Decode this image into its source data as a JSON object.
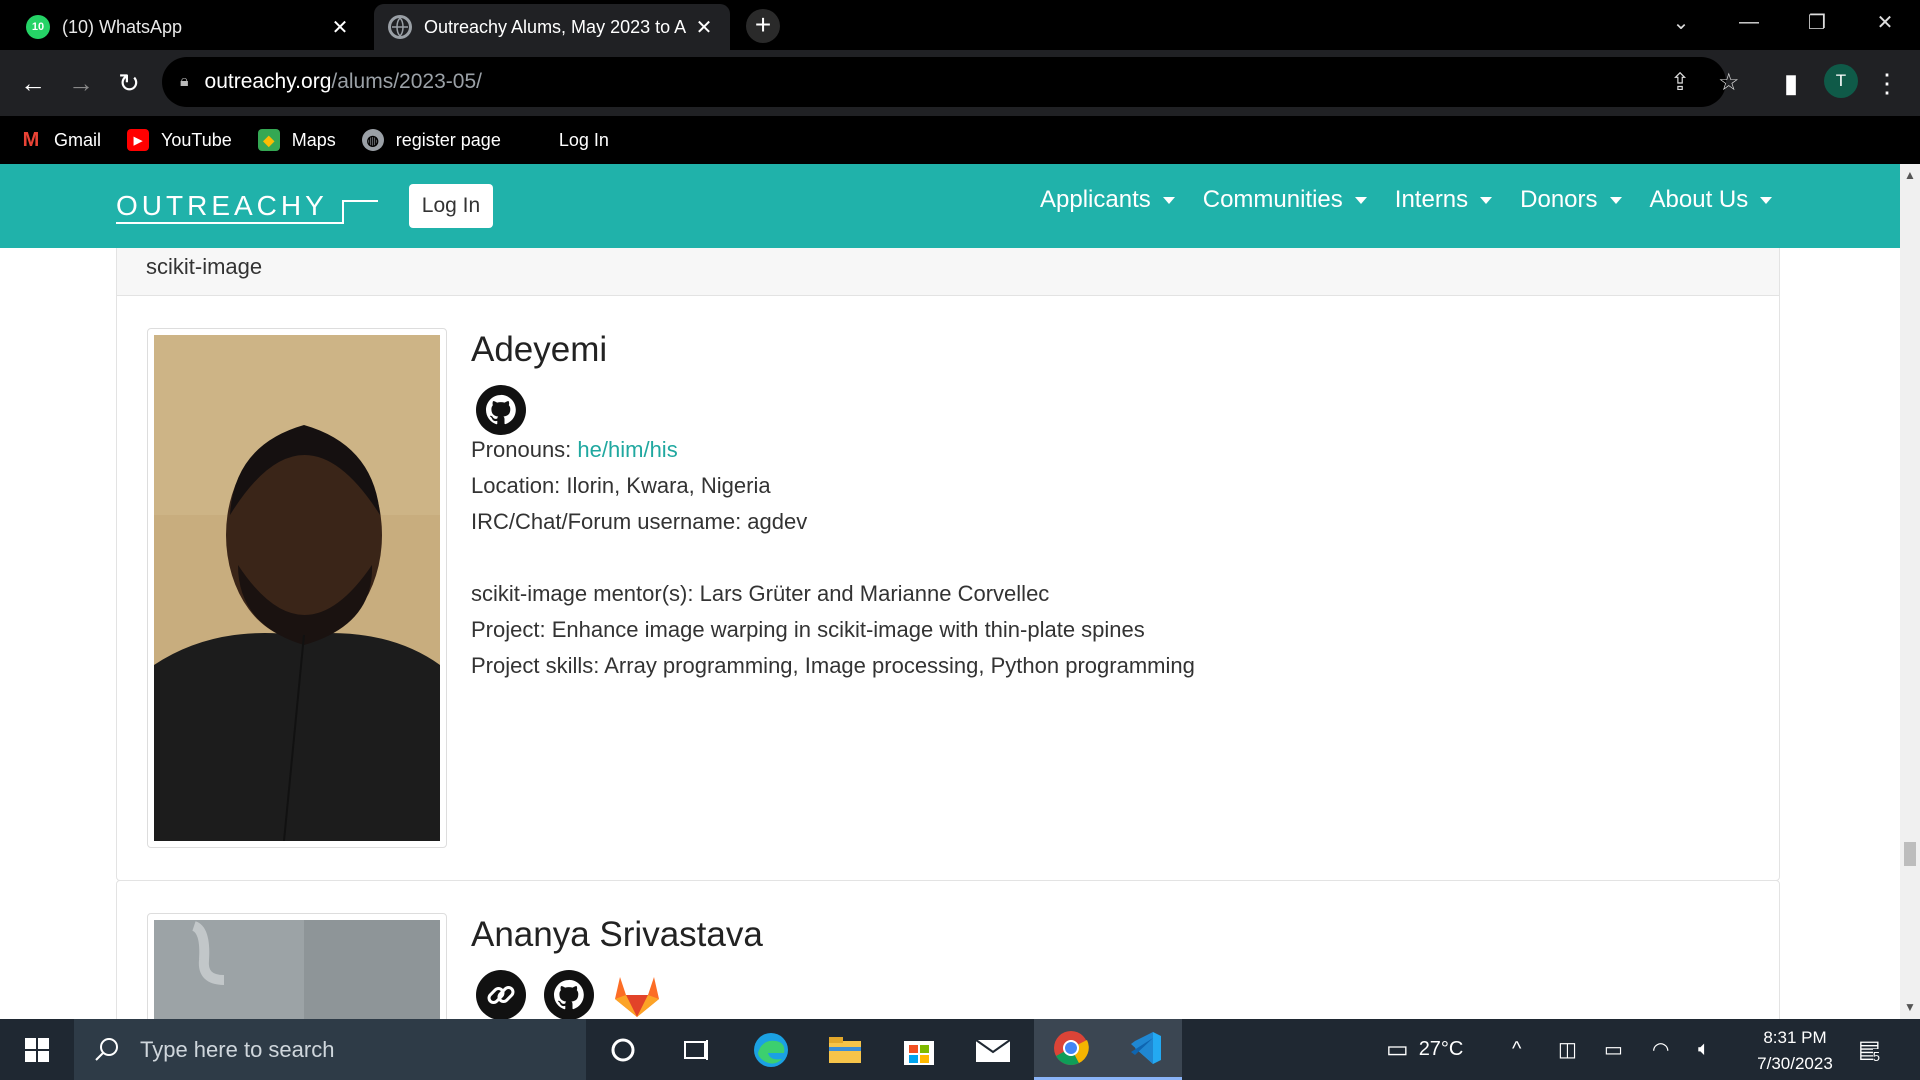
{
  "browser": {
    "tabs": [
      {
        "title": "(10) WhatsApp",
        "badge": "10",
        "favicon": "whatsapp-icon"
      },
      {
        "title": "Outreachy Alums, May 2023 to A",
        "favicon": "globe-icon"
      }
    ],
    "url_host": "outreachy.org",
    "url_path": "/alums/2023-05/",
    "profile_initial": "T",
    "bookmarks": [
      {
        "label": "Gmail",
        "icon": "gmail-icon"
      },
      {
        "label": "YouTube",
        "icon": "youtube-icon"
      },
      {
        "label": "Maps",
        "icon": "maps-icon"
      },
      {
        "label": "register page",
        "icon": "globe-icon"
      },
      {
        "label": "Log In",
        "icon": ""
      }
    ]
  },
  "site": {
    "logo": "OUTREACHY",
    "login_label": "Log In",
    "nav": [
      "Applicants",
      "Communities",
      "Interns",
      "Donors",
      "About Us"
    ],
    "brand_color": "#20b2aa"
  },
  "section": {
    "community": "scikit-image"
  },
  "alums": [
    {
      "name": "Adeyemi",
      "links": [
        "github-icon"
      ],
      "pronouns_label": "Pronouns:",
      "pronouns": "he/him/his",
      "location": "Location: Ilorin, Kwara, Nigeria",
      "username": "IRC/Chat/Forum username: agdev",
      "mentors": "scikit-image mentor(s): Lars Grüter and Marianne Corvellec",
      "project": "Project: Enhance image warping in scikit-image with thin-plate spines",
      "skills": "Project skills: Array programming, Image processing, Python programming"
    },
    {
      "name": "Ananya Srivastava",
      "links": [
        "link-icon",
        "github-icon",
        "gitlab-icon"
      ]
    }
  ],
  "taskbar": {
    "search_placeholder": "Type here to search",
    "temperature": "27°C",
    "time": "8:31 PM",
    "date": "7/30/2023",
    "notifications": "5"
  }
}
